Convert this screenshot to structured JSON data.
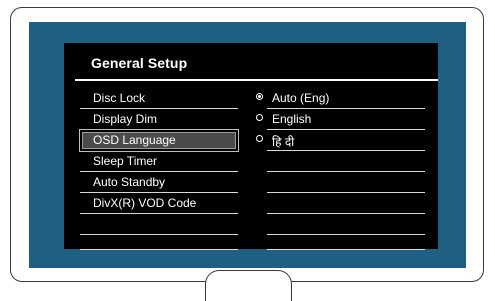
{
  "osd": {
    "title": "General Setup",
    "menu_items": [
      {
        "label": "Disc Lock"
      },
      {
        "label": "Display Dim"
      },
      {
        "label": "OSD Language",
        "selected": true
      },
      {
        "label": "Sleep Timer"
      },
      {
        "label": "Auto Standby"
      },
      {
        "label": "DivX(R) VOD Code"
      },
      {
        "label": ""
      }
    ],
    "options": [
      {
        "label": "Auto (Eng)",
        "checked": true
      },
      {
        "label": "English",
        "checked": false
      },
      {
        "label": "हि दी",
        "checked": false
      },
      {
        "label": ""
      },
      {
        "label": ""
      },
      {
        "label": ""
      },
      {
        "label": ""
      }
    ]
  },
  "colors": {
    "screen_background": "#1f5f82",
    "osd_background": "#000000",
    "text": "#ffffff"
  }
}
